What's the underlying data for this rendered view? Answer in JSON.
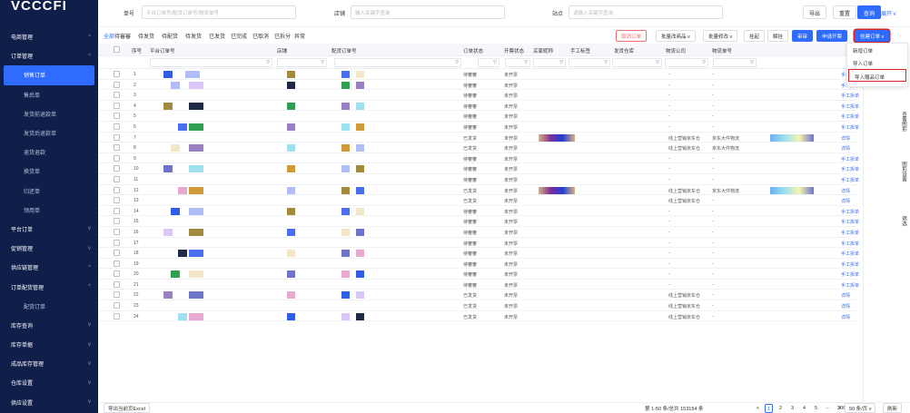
{
  "sidebar": {
    "logo": "VCCCFI",
    "items": [
      {
        "label": "电商管理",
        "type": "group",
        "chev": "^"
      },
      {
        "label": "订单管理",
        "type": "group",
        "chev": "^"
      },
      {
        "label": "销售订单",
        "type": "active"
      },
      {
        "label": "售后单",
        "type": "sub"
      },
      {
        "label": "发货前退款单",
        "type": "sub"
      },
      {
        "label": "发货后退款单",
        "type": "sub"
      },
      {
        "label": "退货退款",
        "type": "sub"
      },
      {
        "label": "换货单",
        "type": "sub"
      },
      {
        "label": "归还单",
        "type": "sub"
      },
      {
        "label": "领用单",
        "type": "sub"
      },
      {
        "label": "平台订单",
        "type": "group",
        "chev": "v"
      },
      {
        "label": "促销管理",
        "type": "group",
        "chev": "v"
      },
      {
        "label": "供应链管理",
        "type": "group",
        "chev": "^"
      },
      {
        "label": "订单配货管理",
        "type": "group",
        "chev": "^"
      },
      {
        "label": "配货订单",
        "type": "sub"
      },
      {
        "label": "库存查询",
        "type": "group",
        "chev": "v"
      },
      {
        "label": "库存单据",
        "type": "group",
        "chev": "v"
      },
      {
        "label": "成品库存管理",
        "type": "group",
        "chev": "v"
      },
      {
        "label": "仓库设置",
        "type": "group",
        "chev": "v"
      },
      {
        "label": "供应设置",
        "type": "group",
        "chev": "v"
      }
    ]
  },
  "filters": {
    "order_label": "单号",
    "order_placeholder": "平台订单号/配货订单号/物流单号",
    "store_label": "店铺",
    "store_placeholder": "输入关键字查询",
    "station_label": "站点",
    "station_placeholder": "请输入关键字查询",
    "export": "导出",
    "reset": "重置",
    "search": "查询",
    "expand": "展开 v"
  },
  "tabs": [
    "全部",
    "待審審",
    "待发货",
    "待配货",
    "待发货",
    "已发货",
    "已完成",
    "已取消",
    "已拆分",
    "异常"
  ],
  "actions": {
    "cancel": "取消订单",
    "batch_goods": "批量改商品 v",
    "batch_edit": "批量修改 v",
    "hold": "挂起",
    "unhold": "解挂",
    "review": "审审",
    "invoice": "申请开票",
    "create": "创建订单 v"
  },
  "dropdown": [
    "新增订单",
    "导入订单",
    "导入赠品订单"
  ],
  "columns": [
    "序号",
    "平台订单号",
    "店铺",
    "配货订单号",
    "订单状态",
    "开票状态",
    "买家昵称",
    "手工标签",
    "发货仓库",
    "物流公司",
    "物流单号"
  ],
  "rows": [
    {
      "n": "1",
      "status": "待審審",
      "inv": "未开票",
      "wh": "-",
      "lg": "-",
      "op": "手工拆单"
    },
    {
      "n": "2",
      "status": "待審審",
      "inv": "未开票",
      "wh": "-",
      "lg": "-",
      "op": "手工拆单"
    },
    {
      "n": "3",
      "status": "待審審",
      "inv": "未开票",
      "wh": "-",
      "lg": "-",
      "op": "手工拆单"
    },
    {
      "n": "4",
      "status": "待審審",
      "inv": "未开票",
      "wh": "-",
      "lg": "-",
      "op": "手工拆单"
    },
    {
      "n": "5",
      "status": "待審審",
      "inv": "未开票",
      "wh": "-",
      "lg": "-",
      "op": "手工拆单"
    },
    {
      "n": "6",
      "status": "待審審",
      "inv": "未开票",
      "wh": "-",
      "lg": "-",
      "op": "手工拆单"
    },
    {
      "n": "7",
      "status": "已发货",
      "inv": "未开票",
      "wh": "线上营销京东仓",
      "lg": "京东大件物流",
      "op": "详情"
    },
    {
      "n": "8",
      "status": "已发货",
      "inv": "未开票",
      "wh": "线上营销京东仓",
      "lg": "京东大件物流",
      "op": "详情"
    },
    {
      "n": "9",
      "status": "待審審",
      "inv": "未开票",
      "wh": "-",
      "lg": "-",
      "op": "手工拆单"
    },
    {
      "n": "10",
      "status": "待審審",
      "inv": "未开票",
      "wh": "-",
      "lg": "-",
      "op": "手工拆单"
    },
    {
      "n": "11",
      "status": "待審審",
      "inv": "未开票",
      "wh": "-",
      "lg": "-",
      "op": "手工拆单"
    },
    {
      "n": "12",
      "status": "已发货",
      "inv": "未开票",
      "wh": "线上营销京东仓",
      "lg": "京东大件物流",
      "op": "详情"
    },
    {
      "n": "13",
      "status": "已发货",
      "inv": "未开票",
      "wh": "线上营销京东仓",
      "lg": "-",
      "op": "详情"
    },
    {
      "n": "14",
      "status": "待審審",
      "inv": "未开票",
      "wh": "-",
      "lg": "-",
      "op": "手工拆单"
    },
    {
      "n": "15",
      "status": "待審審",
      "inv": "未开票",
      "wh": "-",
      "lg": "-",
      "op": "手工拆单"
    },
    {
      "n": "16",
      "status": "待審審",
      "inv": "未开票",
      "wh": "-",
      "lg": "-",
      "op": "手工拆单"
    },
    {
      "n": "17",
      "status": "待審審",
      "inv": "未开票",
      "wh": "-",
      "lg": "-",
      "op": "手工拆单"
    },
    {
      "n": "18",
      "status": "待審審",
      "inv": "未开票",
      "wh": "-",
      "lg": "-",
      "op": "手工拆单"
    },
    {
      "n": "19",
      "status": "待審審",
      "inv": "未开票",
      "wh": "-",
      "lg": "-",
      "op": "手工拆单"
    },
    {
      "n": "20",
      "status": "待審審",
      "inv": "未开票",
      "wh": "-",
      "lg": "-",
      "op": "手工拆单"
    },
    {
      "n": "21",
      "status": "待審審",
      "inv": "未开票",
      "wh": "-",
      "lg": "-",
      "op": "手工拆单"
    },
    {
      "n": "22",
      "status": "已发货",
      "inv": "未开票",
      "wh": "线上营销京东仓",
      "lg": "-",
      "op": "详情"
    },
    {
      "n": "23",
      "status": "已发货",
      "inv": "未开票",
      "wh": "线上营销京东仓",
      "lg": "-",
      "op": "详情"
    },
    {
      "n": "24",
      "status": "已发货",
      "inv": "未开票",
      "wh": "线上营销京东仓",
      "lg": "-",
      "op": "详情"
    }
  ],
  "vtools": [
    "过滤",
    "查看图形",
    "图形设置",
    "筛选"
  ],
  "footer": {
    "export": "导出当前页Excel",
    "total": "第 1-50 条/总共 153154 条",
    "pages": [
      "1",
      "2",
      "3",
      "4",
      "5",
      "···",
      "3064"
    ],
    "size": "50 条/页 v",
    "refresh": "刷新"
  },
  "colors": {
    "sidebar": "#0f1f4a",
    "accent": "#2f6bff",
    "highlight": "#e02020"
  }
}
